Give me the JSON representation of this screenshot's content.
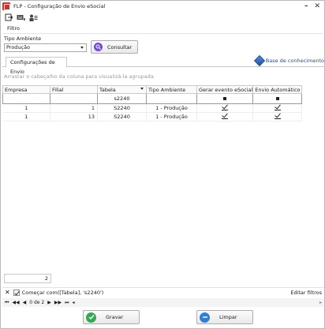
{
  "window": {
    "title": "FLP - Configuração de Envio eSocial",
    "minimize": "–",
    "close": "✕"
  },
  "toolbar": {
    "icons": [
      "exit-icon",
      "keyboard-icon",
      "users-icon"
    ]
  },
  "menu": {
    "filtro": "Filtro"
  },
  "form": {
    "ambiente_label": "Tipo Ambiente",
    "ambiente_value": "Produção",
    "consultar_label": "Consultar"
  },
  "tabs": {
    "active": "Configurações de Envio",
    "kb_link": "Base de conhecimento"
  },
  "grid": {
    "group_hint": "Arrastar o cabeçalho da coluna para visualizá-la agrupada.",
    "columns": [
      "Empresa",
      "Filial",
      "Tabela",
      "Tipo Ambiente",
      "Gerar evento eSocial",
      "Envio Automático"
    ],
    "filter_tabela": "s2240",
    "rows": [
      {
        "empresa": "1",
        "filial": "1",
        "tabela": "S2240",
        "tipo": "1 - Produção"
      },
      {
        "empresa": "1",
        "filial": "13",
        "tabela": "S2240",
        "tipo": "1 - Produção"
      }
    ]
  },
  "footer": {
    "count": "2",
    "filter_text": "Começar com([Tabela], 's2240')",
    "edit_filters": "Editar filtros",
    "pager_text": "0 de 2"
  },
  "buttons": {
    "gravar": "Gravar",
    "limpar": "Limpar"
  },
  "colors": {
    "accent_red": "#d32f2f",
    "link_blue": "#1a4fa8",
    "gravar_green": "#35a853",
    "limpar_blue": "#2f7fd8",
    "consultar_purple": "#6f4bd8"
  }
}
